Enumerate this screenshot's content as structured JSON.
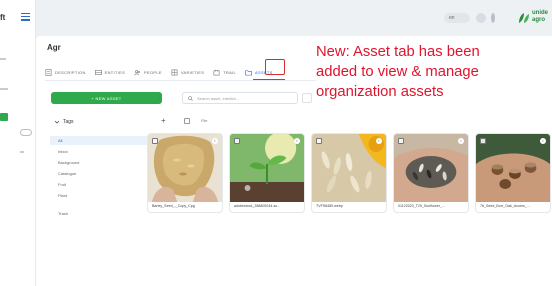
{
  "app": {
    "brand_fragment": "ft",
    "logo_text": "unide\nagro"
  },
  "topbar": {
    "language": "en"
  },
  "page": {
    "title": "Agr"
  },
  "tabs": [
    {
      "label": "DESCRIPTION",
      "icon": "document-icon"
    },
    {
      "label": "ENTITIES",
      "icon": "entities-icon"
    },
    {
      "label": "PEOPLE",
      "icon": "people-icon"
    },
    {
      "label": "VARIETIES",
      "icon": "varieties-icon"
    },
    {
      "label": "TRAIL",
      "icon": "trail-icon"
    },
    {
      "label": "ASSETS",
      "icon": "folder-icon",
      "active": true
    }
  ],
  "assets": {
    "new_button": "+ NEW ASSET",
    "search_placeholder": "Search asset, intellich...",
    "file_label": "File",
    "tags_title": "Tags",
    "tags": [
      {
        "label": "All",
        "active": true
      },
      {
        "label": "Inbox"
      },
      {
        "label": "Background"
      },
      {
        "label": "Catalogue"
      },
      {
        "label": "Fruit"
      },
      {
        "label": "Plant"
      }
    ],
    "trash_label": "Trash",
    "cards": [
      {
        "name": "Barley_Seed_-_Copy_Cpg"
      },
      {
        "name": "adobestock_288809244-sc..."
      },
      {
        "name": "TVFS8489.webp"
      },
      {
        "name": "01122023_T29_Sunflower_..."
      },
      {
        "name": "76_Seed_Burr_Oak_Acorns_..."
      }
    ]
  },
  "annotation": {
    "text": "New: Asset tab has been\nadded to view & manage\norganization assets"
  },
  "colors": {
    "accent_blue": "#2f6ac4",
    "primary_green": "#2eaa4c",
    "annotation_red": "#e0142d"
  }
}
